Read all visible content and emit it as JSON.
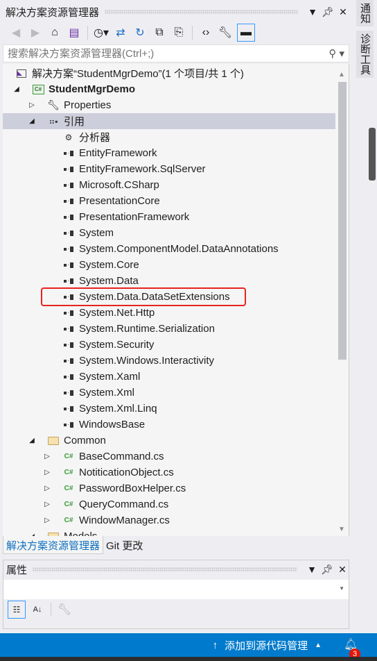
{
  "explorer": {
    "title": "解决方案资源管理器",
    "search_placeholder": "搜索解决方案资源管理器(Ctrl+;)"
  },
  "tree": [
    {
      "level": 0,
      "exp": "",
      "icon": "solution",
      "label": "解决方案“StudentMgrDemo”(1 个项目/共 1 个)"
    },
    {
      "level": 1,
      "exp": "open",
      "icon": "csproj",
      "label": "StudentMgrDemo",
      "bold": true
    },
    {
      "level": 2,
      "exp": "closed",
      "icon": "wrench",
      "label": "Properties"
    },
    {
      "level": 2,
      "exp": "open",
      "icon": "references",
      "label": "引用",
      "selected": true
    },
    {
      "level": 3,
      "exp": "",
      "icon": "analyzer",
      "label": "分析器"
    },
    {
      "level": 3,
      "exp": "",
      "icon": "ref",
      "label": "EntityFramework"
    },
    {
      "level": 3,
      "exp": "",
      "icon": "ref",
      "label": "EntityFramework.SqlServer"
    },
    {
      "level": 3,
      "exp": "",
      "icon": "ref",
      "label": "Microsoft.CSharp"
    },
    {
      "level": 3,
      "exp": "",
      "icon": "ref",
      "label": "PresentationCore"
    },
    {
      "level": 3,
      "exp": "",
      "icon": "ref",
      "label": "PresentationFramework"
    },
    {
      "level": 3,
      "exp": "",
      "icon": "ref",
      "label": "System"
    },
    {
      "level": 3,
      "exp": "",
      "icon": "ref",
      "label": "System.ComponentModel.DataAnnotations"
    },
    {
      "level": 3,
      "exp": "",
      "icon": "ref",
      "label": "System.Core"
    },
    {
      "level": 3,
      "exp": "",
      "icon": "ref",
      "label": "System.Data"
    },
    {
      "level": 3,
      "exp": "",
      "icon": "ref",
      "label": "System.Data.DataSetExtensions"
    },
    {
      "level": 3,
      "exp": "",
      "icon": "ref",
      "label": "System.Net.Http"
    },
    {
      "level": 3,
      "exp": "",
      "icon": "ref",
      "label": "System.Runtime.Serialization"
    },
    {
      "level": 3,
      "exp": "",
      "icon": "ref",
      "label": "System.Security"
    },
    {
      "level": 3,
      "exp": "",
      "icon": "ref",
      "label": "System.Windows.Interactivity",
      "highlighted": true
    },
    {
      "level": 3,
      "exp": "",
      "icon": "ref",
      "label": "System.Xaml"
    },
    {
      "level": 3,
      "exp": "",
      "icon": "ref",
      "label": "System.Xml"
    },
    {
      "level": 3,
      "exp": "",
      "icon": "ref",
      "label": "System.Xml.Linq"
    },
    {
      "level": 3,
      "exp": "",
      "icon": "ref",
      "label": "WindowsBase"
    },
    {
      "level": 2,
      "exp": "open",
      "icon": "folder",
      "label": "Common"
    },
    {
      "level": 3,
      "exp": "closed",
      "icon": "cs",
      "label": "BaseCommand.cs"
    },
    {
      "level": 3,
      "exp": "closed",
      "icon": "cs",
      "label": "NotiticationObject.cs"
    },
    {
      "level": 3,
      "exp": "closed",
      "icon": "cs",
      "label": "PasswordBoxHelper.cs"
    },
    {
      "level": 3,
      "exp": "closed",
      "icon": "cs",
      "label": "QueryCommand.cs"
    },
    {
      "level": 3,
      "exp": "closed",
      "icon": "cs",
      "label": "WindowManager.cs"
    },
    {
      "level": 2,
      "exp": "open",
      "icon": "folder",
      "label": "Models"
    }
  ],
  "tabs": [
    {
      "label": "解决方案资源管理器",
      "active": true
    },
    {
      "label": "Git 更改"
    }
  ],
  "properties": {
    "title": "属性"
  },
  "side": {
    "notifications": "通知",
    "diagnostics": "诊断工具"
  },
  "status": {
    "source_control": "添加到源代码管理",
    "notification_count": "3"
  },
  "colors": {
    "status_bar": "#007acc",
    "highlight_box": "#e8231f",
    "selection": "#cccedb"
  }
}
